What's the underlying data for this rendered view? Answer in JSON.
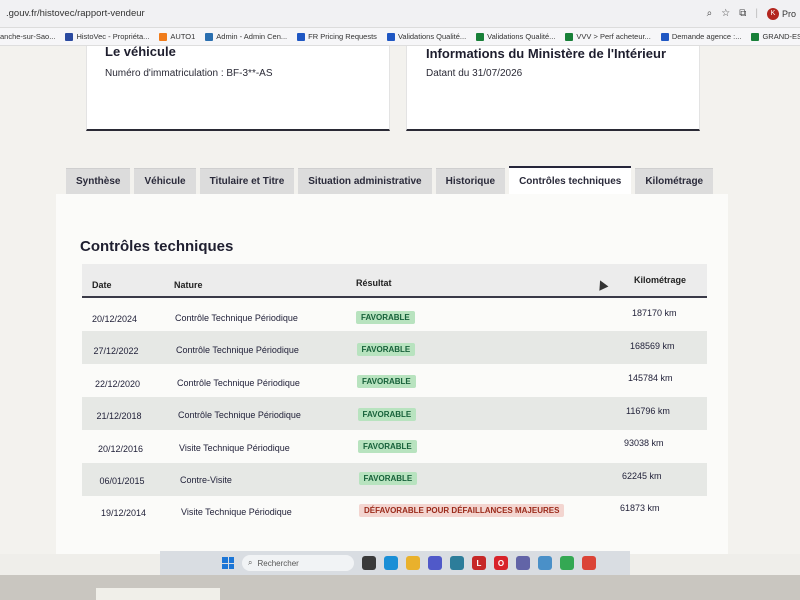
{
  "browser": {
    "url": ".gouv.fr/histovec/rapport-vendeur",
    "profile_initial": "K",
    "profile_label": "Pro",
    "bookmarks": [
      {
        "label": "anche-sur-Sao...",
        "icon": "page-icon",
        "color": "#9aa0a6"
      },
      {
        "label": "HistoVec - Propriéta...",
        "icon": "flag-icon",
        "color": "#2b4aa0"
      },
      {
        "label": "AUTO1",
        "icon": "auto1-icon",
        "color": "#f07c1b"
      },
      {
        "label": "Admin - Admin Cen...",
        "icon": "admin-icon",
        "color": "#2a6fb0"
      },
      {
        "label": "FR Pricing Requests",
        "icon": "doc-icon",
        "color": "#1f57c3"
      },
      {
        "label": "Validations Qualité...",
        "icon": "doc-icon",
        "color": "#1f57c3"
      },
      {
        "label": "Validations Qualité...",
        "icon": "sheet-icon",
        "color": "#188038"
      },
      {
        "label": "VVV > Perf acheteur...",
        "icon": "sheet-icon",
        "color": "#188038"
      },
      {
        "label": "Demande agence :...",
        "icon": "doc-icon",
        "color": "#1f57c3"
      },
      {
        "label": "GRAND-EST - Goog...",
        "icon": "sheet-icon",
        "color": "#188038"
      }
    ]
  },
  "vehicle_card": {
    "title": "Le véhicule",
    "registration": "Numéro d'immatriculation : BF-3**-AS"
  },
  "ministry_card": {
    "title": "Informations du Ministère de l'Intérieur",
    "date": "Datant du 31/07/2026"
  },
  "tabs": [
    {
      "label": "Synthèse",
      "active": false
    },
    {
      "label": "Véhicule",
      "active": false
    },
    {
      "label": "Titulaire et Titre",
      "active": false
    },
    {
      "label": "Situation administrative",
      "active": false
    },
    {
      "label": "Historique",
      "active": false
    },
    {
      "label": "Contrôles techniques",
      "active": true
    },
    {
      "label": "Kilométrage",
      "active": false
    }
  ],
  "controls": {
    "title": "Contrôles techniques",
    "headers": {
      "date": "Date",
      "nature": "Nature",
      "result": "Résultat",
      "km": "Kilométrage"
    },
    "rows": [
      {
        "date": "20/12/2024",
        "nature": "Contrôle Technique Périodique",
        "result": "FAVORABLE",
        "status": "ok",
        "km": "187170 km"
      },
      {
        "date": "27/12/2022",
        "nature": "Contrôle Technique Périodique",
        "result": "FAVORABLE",
        "status": "ok",
        "km": "168569 km"
      },
      {
        "date": "22/12/2020",
        "nature": "Contrôle Technique Périodique",
        "result": "FAVORABLE",
        "status": "ok",
        "km": "145784 km"
      },
      {
        "date": "21/12/2018",
        "nature": "Contrôle Technique Périodique",
        "result": "FAVORABLE",
        "status": "ok",
        "km": "116796 km"
      },
      {
        "date": "20/12/2016",
        "nature": "Visite Technique Périodique",
        "result": "FAVORABLE",
        "status": "ok",
        "km": "93038 km"
      },
      {
        "date": "06/01/2015",
        "nature": "Contre-Visite",
        "result": "FAVORABLE",
        "status": "ok",
        "km": "62245 km"
      },
      {
        "date": "19/12/2014",
        "nature": "Visite Technique Périodique",
        "result": "DÉFAVORABLE POUR DÉFAILLANCES MAJEURES",
        "status": "bad",
        "km": "61873 km"
      }
    ]
  },
  "taskbar": {
    "search_label": "Rechercher",
    "apps": [
      {
        "icon": "widgets-icon",
        "color": "#3a3a3a",
        "glyph": ""
      },
      {
        "icon": "edge-icon",
        "color": "#1a8fd6",
        "glyph": ""
      },
      {
        "icon": "folder-icon",
        "color": "#e9b12c",
        "glyph": ""
      },
      {
        "icon": "teams-icon",
        "color": "#5059c9",
        "glyph": ""
      },
      {
        "icon": "store-icon",
        "color": "#2d7d9a",
        "glyph": ""
      },
      {
        "icon": "l-app-icon",
        "color": "#c62828",
        "glyph": "L"
      },
      {
        "icon": "opera-icon",
        "color": "#d8232a",
        "glyph": "O"
      },
      {
        "icon": "chat-icon",
        "color": "#6264a7",
        "glyph": ""
      },
      {
        "icon": "phone-icon",
        "color": "#4a90c8",
        "glyph": ""
      },
      {
        "icon": "chrome-icon",
        "color": "#34a853",
        "glyph": ""
      },
      {
        "icon": "chrome-profile-icon",
        "color": "#db4437",
        "glyph": ""
      }
    ]
  }
}
